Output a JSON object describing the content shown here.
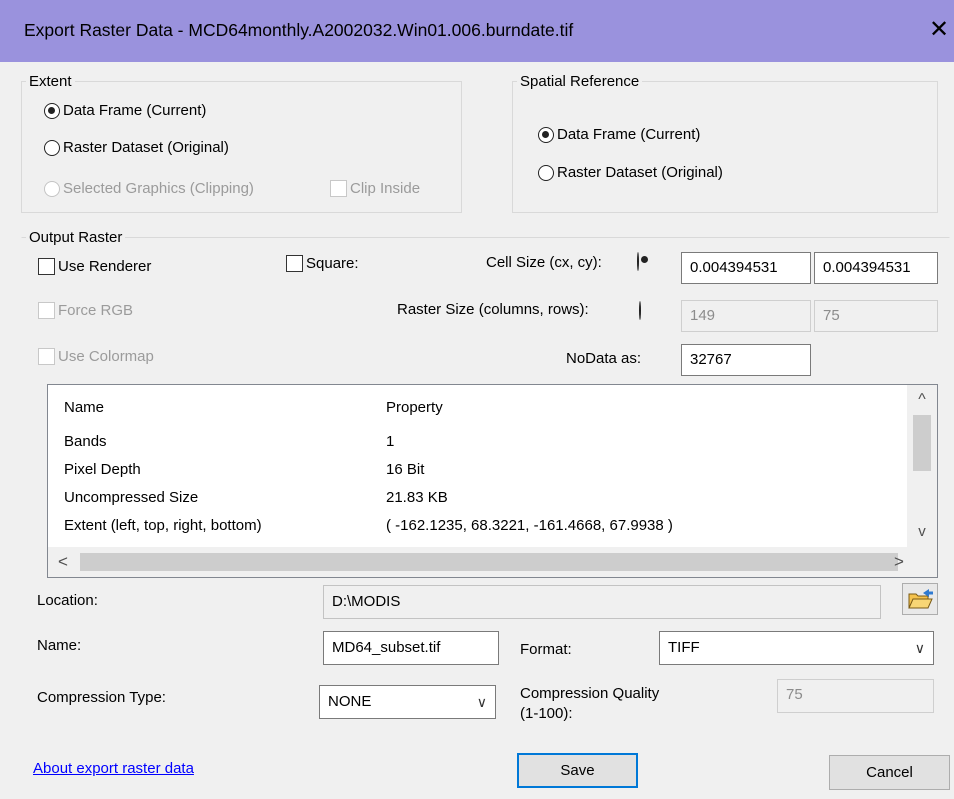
{
  "window": {
    "title": "Export Raster Data - MCD64monthly.A2002032.Win01.006.burndate.tif",
    "close_glyph": "✕"
  },
  "extent": {
    "legend": "Extent",
    "data_frame": "Data Frame (Current)",
    "raster_dataset": "Raster Dataset (Original)",
    "selected_graphics": "Selected Graphics (Clipping)",
    "clip_inside": "Clip Inside",
    "selected": "data_frame"
  },
  "spatial_reference": {
    "legend": "Spatial Reference",
    "data_frame": "Data Frame (Current)",
    "raster_dataset": "Raster Dataset (Original)",
    "selected": "data_frame"
  },
  "output_raster": {
    "legend": "Output Raster",
    "use_renderer": "Use Renderer",
    "square": "Square:",
    "force_rgb": "Force RGB",
    "use_colormap": "Use Colormap",
    "cell_size_label": "Cell Size (cx, cy):",
    "cell_size_x": "0.004394531",
    "cell_size_y": "0.004394531",
    "raster_size_label": "Raster Size (columns, rows):",
    "columns": "149",
    "rows": "75",
    "nodata_label": "NoData as:",
    "nodata_value": "32767",
    "selected_size_mode": "cell_size"
  },
  "properties": {
    "header_name": "Name",
    "header_property": "Property",
    "rows": [
      {
        "name": "Bands",
        "value": "1"
      },
      {
        "name": "Pixel Depth",
        "value": "16 Bit"
      },
      {
        "name": "Uncompressed Size",
        "value": "21.83 KB"
      },
      {
        "name": "Extent (left, top, right, bottom)",
        "value": "( -162.1235, 68.3221, -161.4668, 67.9938 )"
      }
    ],
    "scroll_up": "^",
    "scroll_down": "v",
    "scroll_left": "<",
    "scroll_right": ">"
  },
  "location": {
    "label": "Location:",
    "value": "D:\\MODIS"
  },
  "name": {
    "label": "Name:",
    "value": "MD64_subset.tif"
  },
  "format": {
    "label": "Format:",
    "value": "TIFF"
  },
  "compression": {
    "type_label": "Compression Type:",
    "type_value": "NONE",
    "quality_label_line1": "Compression Quality",
    "quality_label_line2": "(1-100):",
    "quality_value": "75"
  },
  "footer": {
    "about_link": "About export raster data",
    "save": "Save",
    "cancel": "Cancel"
  },
  "colors": {
    "titlebar": "#9a92dd",
    "dialog_bg": "#f0f0f0",
    "default_button_border": "#0078d7",
    "link": "#0000ff"
  }
}
